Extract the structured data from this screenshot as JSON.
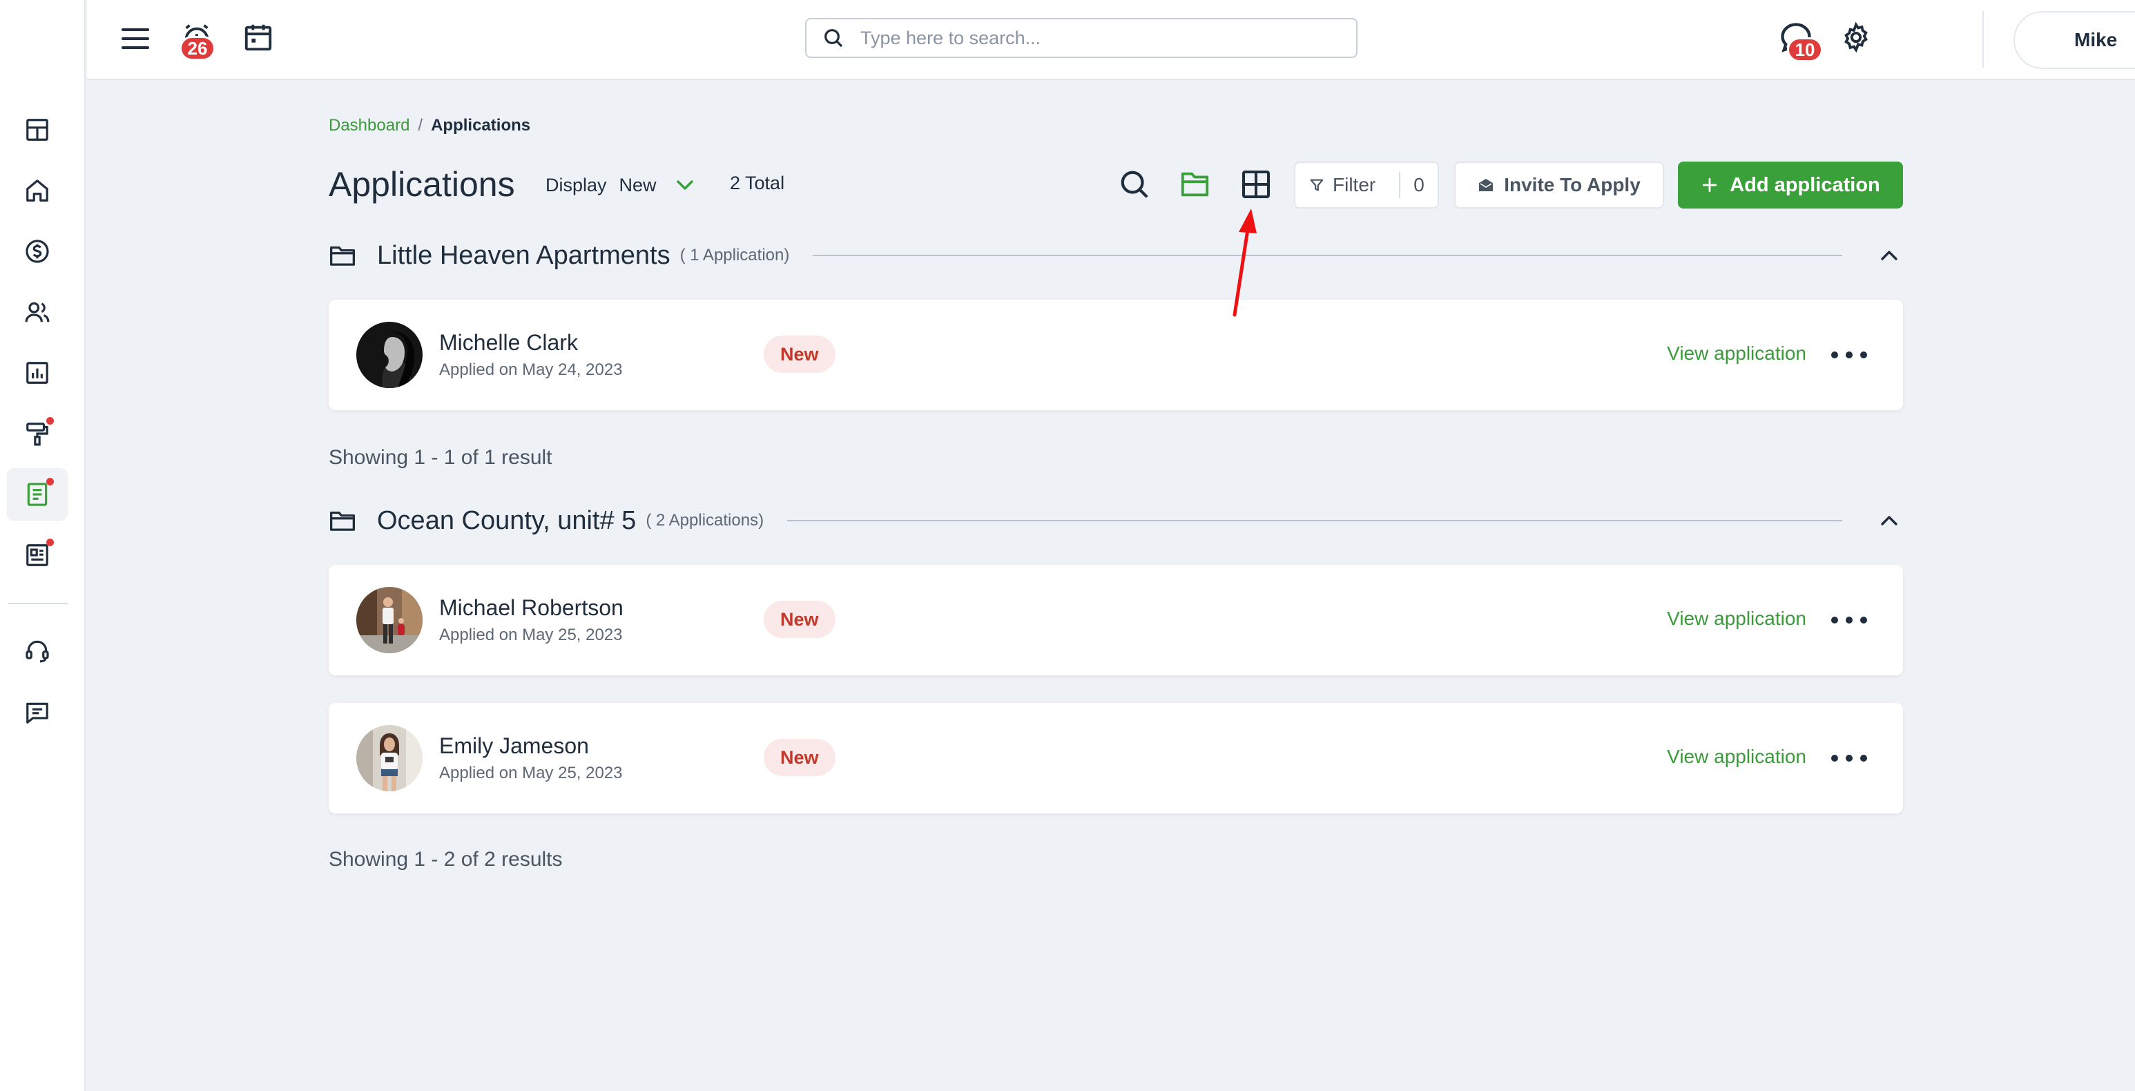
{
  "colors": {
    "accent_green": "#3aa13a",
    "link_green": "#3a9a3a",
    "badge_red": "#e03b3b",
    "status_bg": "#fbe9e9",
    "status_text": "#c0392b",
    "annotation_arrow": "#ee1111"
  },
  "sidebar": {
    "items": [
      {
        "icon": "grid-icon"
      },
      {
        "icon": "home-icon"
      },
      {
        "icon": "dollar-icon"
      },
      {
        "icon": "users-icon"
      },
      {
        "icon": "bar-chart-icon"
      },
      {
        "icon": "paint-roller-icon",
        "dot": true
      },
      {
        "icon": "document-icon",
        "active": true,
        "dot": true
      },
      {
        "icon": "newspaper-icon",
        "dot": true
      },
      {
        "icon": "headset-icon"
      },
      {
        "icon": "chat-icon"
      }
    ]
  },
  "topbar": {
    "menu_icon": "hamburger-icon",
    "alarm_icon": "alarm-clock-icon",
    "alarm_badge": "26",
    "calendar_icon": "calendar-icon",
    "search_placeholder": "Type here to search...",
    "search_value": "",
    "messages_icon": "chat-bubble-icon",
    "messages_badge": "10",
    "settings_icon": "gear-icon",
    "user_name": "Mike"
  },
  "breadcrumb": {
    "parent": "Dashboard",
    "separator": "/",
    "current": "Applications"
  },
  "header": {
    "title": "Applications",
    "display_label": "Display",
    "display_value": "New",
    "total": "2 Total",
    "filter_label": "Filter",
    "filter_count": "0",
    "invite_label": "Invite To Apply",
    "add_label": "Add application"
  },
  "groups": [
    {
      "name": "Little Heaven Apartments",
      "count": "( 1 Application)",
      "applications": [
        {
          "name": "Michelle Clark",
          "date": "Applied on May 24, 2023",
          "status": "New",
          "link": "View application"
        }
      ],
      "result": "Showing 1 - 1 of 1 result"
    },
    {
      "name": "Ocean County, unit# 5",
      "count": "( 2 Applications)",
      "applications": [
        {
          "name": "Michael Robertson",
          "date": "Applied on May 25, 2023",
          "status": "New",
          "link": "View application"
        },
        {
          "name": "Emily Jameson",
          "date": "Applied on May 25, 2023",
          "status": "New",
          "link": "View application"
        }
      ],
      "result": "Showing 1 - 2 of 2 results"
    }
  ]
}
